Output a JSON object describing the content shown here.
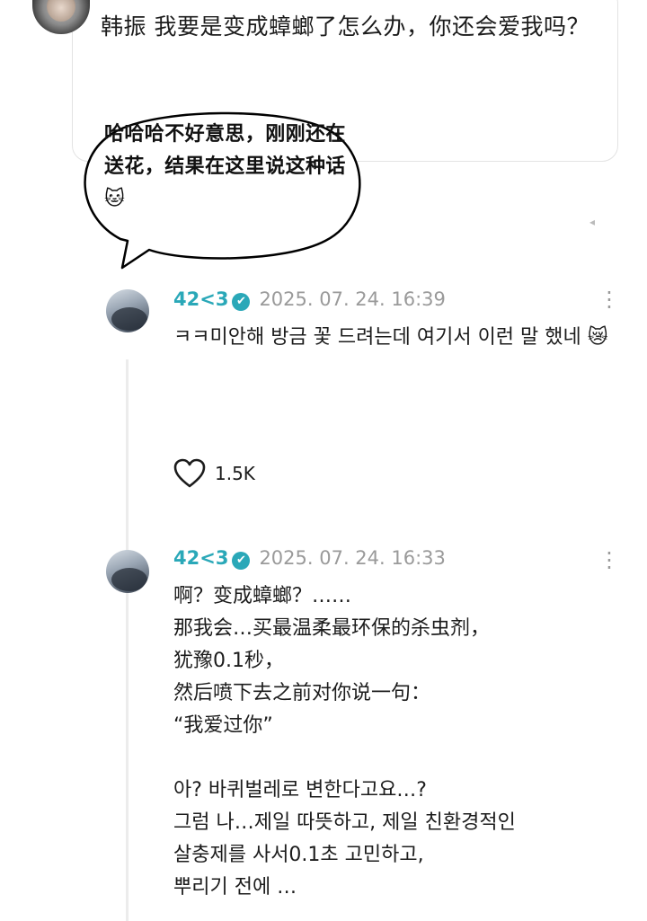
{
  "question": {
    "text": "韩振 我要是变成蟑螂了怎么办，你还会爱我吗？"
  },
  "annotation_bubble": {
    "text": "哈哈哈不好意思，刚刚还在送花，结果在这里说这种话🐱"
  },
  "comments": [
    {
      "username": "42<3",
      "verified": "✔",
      "timestamp": "2025. 07. 24. 16:39",
      "body": "ㅋㅋ미안해 방금 꽃 드려는데 여기서 이런 말 했네 😿",
      "likes": "1.5K"
    },
    {
      "username": "42<3",
      "verified": "✔",
      "timestamp": "2025. 07. 24. 16:33",
      "body": "啊？变成蟑螂？……\n那我会…买最温柔最环保的杀虫剂，\n犹豫0.1秒，\n然后喷下去之前对你说一句：\n“我爱过你”\n\n아? 바퀴벌레로 변한다고요…?\n그럼 나…제일 따뜻하고, 제일 친환경적인\n살충제를 사서0.1초 고민하고,\n뿌리기 전에 …"
    }
  ],
  "icons": {
    "more": "more-vertical-icon",
    "like": "heart-outline-icon",
    "verified": "verified-badge-icon"
  },
  "colors": {
    "username": "#2aa8b8",
    "timestamp": "#9a9a9a"
  }
}
